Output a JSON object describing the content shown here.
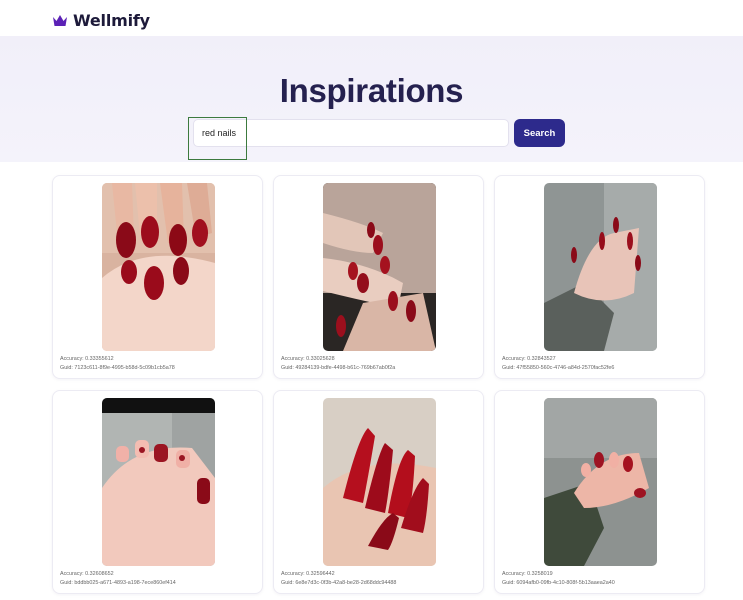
{
  "brand": {
    "name": "Wellmify",
    "icon": "crown-icon",
    "color": "#5b21b6"
  },
  "hero": {
    "title": "Inspirations"
  },
  "search": {
    "value": "red nails",
    "button_label": "Search",
    "button_color": "#2d2a8c"
  },
  "results": [
    {
      "accuracy": "Accuracy: 0.33355612",
      "guid": "Guid: 7123c611-8f9e-4995-b58d-5c09b1cb5a78"
    },
    {
      "accuracy": "Accuracy: 0.33025628",
      "guid": "Guid: 49284139-bdfe-4498-b61c-769b67ab0f2a"
    },
    {
      "accuracy": "Accuracy: 0.32843527",
      "guid": "Guid: 47f55850-560c-4746-a84d-2570fac52fe6"
    },
    {
      "accuracy": "Accuracy: 0.32608652",
      "guid": "Guid: bddbb025-a671-4893-a198-7ece860ef414"
    },
    {
      "accuracy": "Accuracy: 0.32596442",
      "guid": "Guid: 6e8e7d3c-0f3b-42a8-be28-2d68ddc94488"
    },
    {
      "accuracy": "Accuracy: 0.3258019",
      "guid": "Guid: 6094afb0-09fb-4c10-808f-5b13aaea2a40"
    }
  ]
}
